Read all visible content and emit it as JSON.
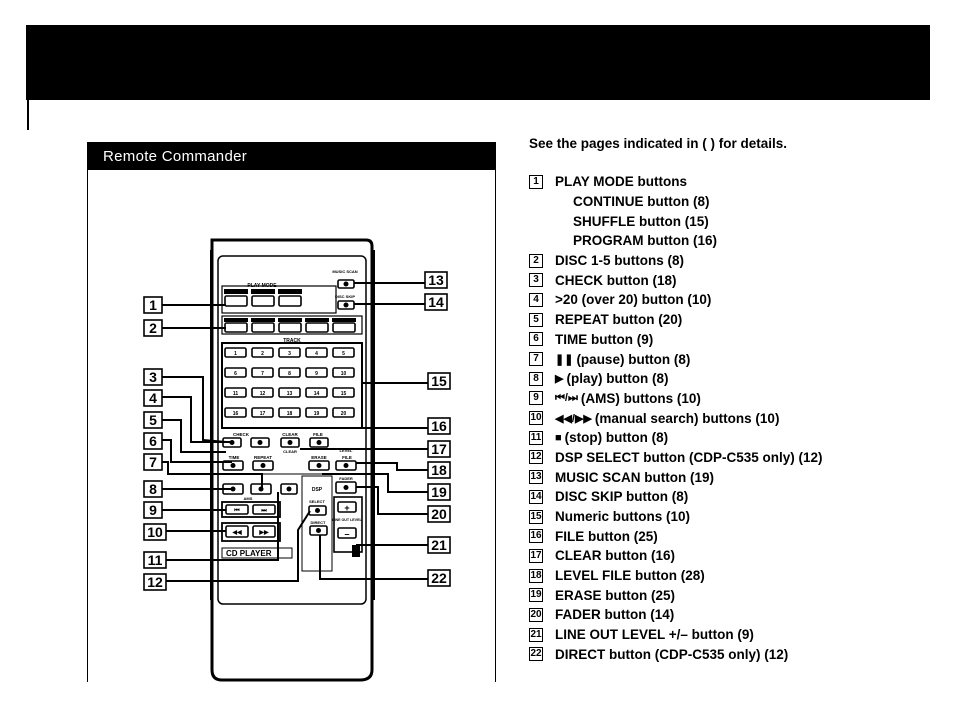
{
  "header": {
    "band_color": "#000000"
  },
  "panel": {
    "title": "Remote Commander"
  },
  "intro_text": "See the pages indicated in (    ) for details.",
  "remote": {
    "play_mode_label": "PLAY MODE",
    "play_mode_buttons": [
      "CONTINUE",
      "SHUFFLE",
      "PROGRAM"
    ],
    "disc_buttons": [
      "DISC 1",
      "DISC 2",
      "DISC 3",
      "DISC 4",
      "DISC 5"
    ],
    "music_scan_label": "MUSIC SCAN",
    "disc_skip_label": "DISC SKIP",
    "track_label": "TRACK",
    "numeric_keys": [
      "1",
      "2",
      "3",
      "4",
      "5",
      "6",
      "7",
      "8",
      "9",
      "10",
      "11",
      "12",
      "13",
      "14",
      "15",
      "16",
      "17",
      "18",
      "19",
      "20"
    ],
    "check_label": "CHECK",
    "clear_label": "CLEAR",
    "file_label": "FILE",
    "clear_sub_label": "CLEAR",
    "level_label": "LEVEL",
    "time_label": "TIME",
    "repeat_label": "REPEAT",
    "erase_label": "ERASE",
    "level_file_label": "FILE",
    "dsp_label": "DSP",
    "select_label": "SELECT",
    "direct_label": "DIRECT",
    "fader_label": "FADER",
    "line_out_level_label": "LINE OUT LEVEL",
    "plus_label": "+",
    "minus_label": "–",
    "ams_label": "AMS",
    "prev_label": "⏮",
    "next_label": "⏭",
    "rew_label": "◀◀",
    "ff_label": "▶▶",
    "cd_player_label": "CD PLAYER"
  },
  "callouts": {
    "left": [
      "1",
      "2",
      "3",
      "4",
      "5",
      "6",
      "7",
      "8",
      "9",
      "10",
      "11",
      "12"
    ],
    "right": [
      "13",
      "14",
      "15",
      "16",
      "17",
      "18",
      "19",
      "20",
      "21",
      "22"
    ]
  },
  "legend": [
    {
      "num": "1",
      "text": "PLAY MODE buttons"
    },
    {
      "sub": true,
      "text": "CONTINUE button (8)"
    },
    {
      "sub": true,
      "text": "SHUFFLE button (15)"
    },
    {
      "sub": true,
      "text": "PROGRAM button (16)"
    },
    {
      "num": "2",
      "text": "DISC 1-5 buttons (8)"
    },
    {
      "num": "3",
      "text": "CHECK button (18)"
    },
    {
      "num": "4",
      "text": ">20 (over 20) button (10)"
    },
    {
      "num": "5",
      "text": "REPEAT button (20)"
    },
    {
      "num": "6",
      "text": "TIME button (9)"
    },
    {
      "num": "7",
      "glyph": "❚❚",
      "icon": "pause-icon",
      "text": "(pause) button (8)"
    },
    {
      "num": "8",
      "glyph": "▶",
      "icon": "play-icon",
      "text": "(play) button (8)"
    },
    {
      "num": "9",
      "glyph": "⏮/⏭",
      "icon": "ams-icon",
      "text": "(AMS) buttons (10)"
    },
    {
      "num": "10",
      "glyph": "◀◀/▶▶",
      "icon": "manual-search-icon",
      "text": "(manual search) buttons (10)"
    },
    {
      "num": "11",
      "glyph": "■",
      "icon": "stop-icon",
      "text": "(stop) button (8)"
    },
    {
      "num": "12",
      "text": "DSP SELECT button (CDP-C535 only) (12)"
    },
    {
      "num": "13",
      "text": "MUSIC SCAN button (19)"
    },
    {
      "num": "14",
      "text": "DISC SKIP button (8)"
    },
    {
      "num": "15",
      "text": "Numeric buttons (10)"
    },
    {
      "num": "16",
      "text": "FILE button (25)"
    },
    {
      "num": "17",
      "text": "CLEAR button (16)"
    },
    {
      "num": "18",
      "text": "LEVEL FILE button (28)"
    },
    {
      "num": "19",
      "text": "ERASE button (25)"
    },
    {
      "num": "20",
      "text": "FADER button (14)"
    },
    {
      "num": "21",
      "text": "LINE OUT LEVEL +/– button (9)"
    },
    {
      "num": "22",
      "text": "DIRECT button (CDP-C535 only) (12)"
    }
  ]
}
